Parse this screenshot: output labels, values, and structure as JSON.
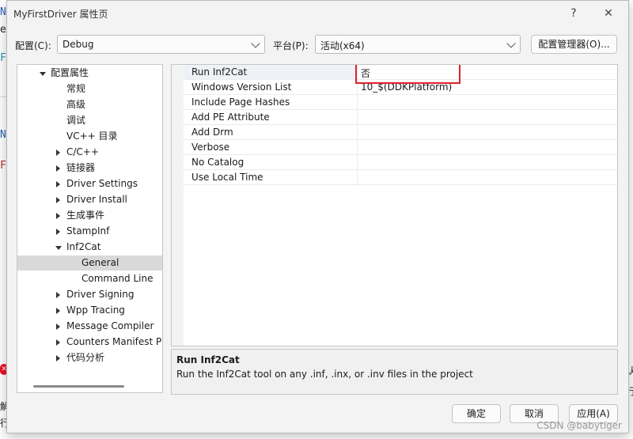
{
  "background": {
    "fragments": [
      "N",
      "e",
      "F",
      "N",
      "F",
      "解",
      "行",
      "认",
      "行"
    ]
  },
  "dialog": {
    "title": "MyFirstDriver 属性页",
    "help_glyph": "?",
    "close_glyph": "✕"
  },
  "toolbar": {
    "config_label": "配置(C):",
    "config_value": "Debug",
    "platform_label": "平台(P):",
    "platform_value": "活动(x64)",
    "config_manager_label": "配置管理器(O)..."
  },
  "tree": {
    "items": [
      {
        "label": "配置属性",
        "level": 0,
        "arrow": "down"
      },
      {
        "label": "常规",
        "level": 1,
        "arrow": "none"
      },
      {
        "label": "高级",
        "level": 1,
        "arrow": "none"
      },
      {
        "label": "调试",
        "level": 1,
        "arrow": "none"
      },
      {
        "label": "VC++ 目录",
        "level": 1,
        "arrow": "none"
      },
      {
        "label": "C/C++",
        "level": 1,
        "arrow": "right"
      },
      {
        "label": "链接器",
        "level": 1,
        "arrow": "right"
      },
      {
        "label": "Driver Settings",
        "level": 1,
        "arrow": "right"
      },
      {
        "label": "Driver Install",
        "level": 1,
        "arrow": "right"
      },
      {
        "label": "生成事件",
        "level": 1,
        "arrow": "right"
      },
      {
        "label": "StampInf",
        "level": 1,
        "arrow": "right"
      },
      {
        "label": "Inf2Cat",
        "level": 1,
        "arrow": "down"
      },
      {
        "label": "General",
        "level": 2,
        "arrow": "none",
        "selected": true
      },
      {
        "label": "Command Line",
        "level": 2,
        "arrow": "none"
      },
      {
        "label": "Driver Signing",
        "level": 1,
        "arrow": "right"
      },
      {
        "label": "Wpp Tracing",
        "level": 1,
        "arrow": "right"
      },
      {
        "label": "Message Compiler",
        "level": 1,
        "arrow": "right"
      },
      {
        "label": "Counters Manifest Prepr",
        "level": 1,
        "arrow": "right"
      },
      {
        "label": "代码分析",
        "level": 1,
        "arrow": "right"
      }
    ]
  },
  "properties": [
    {
      "name": "Run Inf2Cat",
      "value": "否"
    },
    {
      "name": "Windows Version List",
      "value": "10_$(DDKPlatform)"
    },
    {
      "name": "Include Page Hashes",
      "value": ""
    },
    {
      "name": "Add PE Attribute",
      "value": ""
    },
    {
      "name": "Add Drm",
      "value": ""
    },
    {
      "name": "Verbose",
      "value": ""
    },
    {
      "name": "No Catalog",
      "value": ""
    },
    {
      "name": "Use Local Time",
      "value": ""
    }
  ],
  "description": {
    "title": "Run Inf2Cat",
    "text": "Run the Inf2Cat tool on any .inf, .inx, or .inv files in the project"
  },
  "buttons": {
    "ok": "确定",
    "cancel": "取消",
    "apply": "应用(A)"
  },
  "watermark": "CSDN @babytiger",
  "colors": {
    "highlight_border": "#e0212b",
    "selected_tree_bg": "#d9d9d9"
  }
}
